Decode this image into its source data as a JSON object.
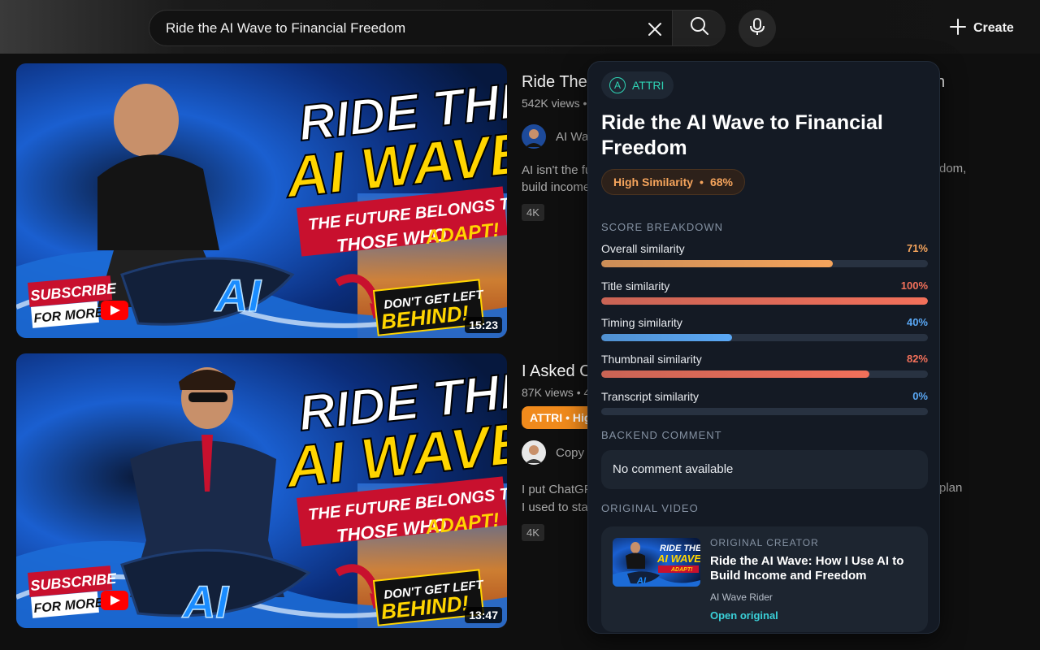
{
  "search": {
    "query": "Ride the AI Wave to Financial Freedom"
  },
  "header": {
    "create_label": "Create"
  },
  "videos": [
    {
      "title_visible": "Ride The",
      "title_tail": "n",
      "meta": "542K views •",
      "channel": "AI Wa",
      "desc_line1": "AI isn't the fu",
      "desc_line1_tail": "dom,",
      "desc_line2": "build income",
      "quality": "4K",
      "duration": "15:23",
      "thumb_headline1": "RIDE THE",
      "thumb_headline2": "AI WAVE",
      "thumb_banner1": "THE FUTURE BELONGS TO",
      "thumb_banner2": "THOSE WHO",
      "thumb_banner_accent": "ADAPT!",
      "thumb_board": "AI",
      "thumb_sub1": "SUBSCRIBE",
      "thumb_sub2": "FOR MORE!",
      "thumb_cta1": "DON'T GET LEFT",
      "thumb_cta2": "BEHIND!"
    },
    {
      "title_visible": "I Asked C",
      "meta": "87K views • 4",
      "attri_chip": "ATTRI • Hig",
      "channel": "Copy",
      "desc_line1": "I put ChatGF",
      "desc_line1_tail": "plan",
      "desc_line2": "I used to sta",
      "quality": "4K",
      "duration": "13:47",
      "thumb_headline1": "RIDE THE",
      "thumb_headline2": "AI WAVE",
      "thumb_banner1": "THE FUTURE BELONGS TO",
      "thumb_banner2": "THOSE WHO",
      "thumb_banner_accent": "ADAPT!",
      "thumb_board": "AI",
      "thumb_sub1": "SUBSCRIBE",
      "thumb_sub2": "FOR MORE!",
      "thumb_cta1": "DON'T GET LEFT",
      "thumb_cta2": "BEHIND!"
    }
  ],
  "panel": {
    "brand": "ATTRI",
    "brand_glyph": "A",
    "title": "Ride the AI Wave to Financial Freedom",
    "similarity_label": "High Similarity",
    "similarity_value": "68%",
    "score_section": "SCORE BREAKDOWN",
    "scores": [
      {
        "label": "Overall similarity",
        "value": "71%",
        "fraction": 0.71,
        "color": "#f5a45c"
      },
      {
        "label": "Title similarity",
        "value": "100%",
        "fraction": 1.0,
        "color": "#f2705a"
      },
      {
        "label": "Timing similarity",
        "value": "40%",
        "fraction": 0.4,
        "color": "#5aa8f5"
      },
      {
        "label": "Thumbnail similarity",
        "value": "82%",
        "fraction": 0.82,
        "color": "#f2705a"
      },
      {
        "label": "Transcript similarity",
        "value": "0%",
        "fraction": 0.0,
        "color": "#5aa8f5"
      }
    ],
    "comment_section": "BACKEND COMMENT",
    "comment": "No comment available",
    "original_section": "ORIGINAL VIDEO",
    "original": {
      "kicker": "ORIGINAL CREATOR",
      "title": "Ride the AI Wave: How I Use AI to Build Income and Freedom",
      "channel": "AI Wave Rider",
      "link": "Open original",
      "thumb_line1": "RIDE THE",
      "thumb_line2": "AI WAVE",
      "thumb_accent": "ADAPT!",
      "thumb_board": "AI"
    }
  }
}
